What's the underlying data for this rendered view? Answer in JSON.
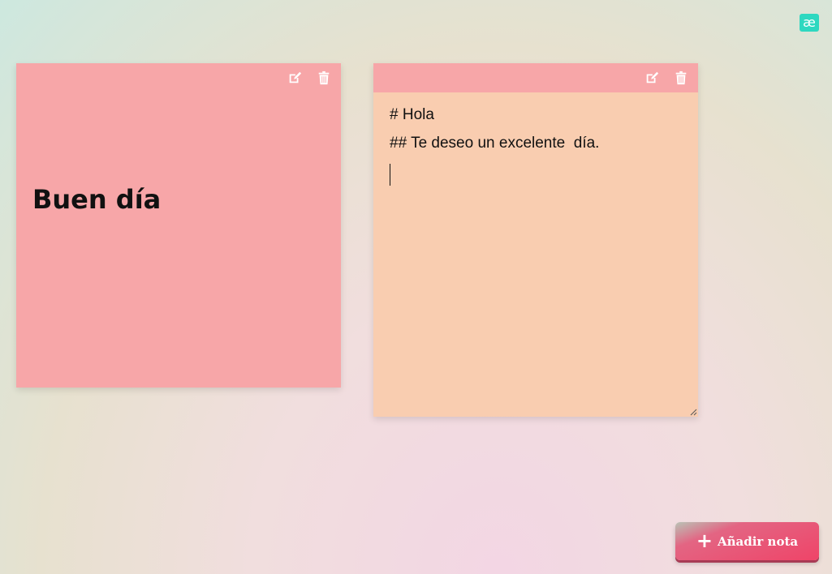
{
  "app": {
    "logo_text": "æ",
    "logo_color": "#2ed8c0"
  },
  "notes": [
    {
      "rendered_title": "Buen día",
      "background": "#f7a6a8",
      "actions": [
        {
          "name": "edit",
          "icon": "edit-icon"
        },
        {
          "name": "delete",
          "icon": "trash-icon"
        }
      ]
    },
    {
      "mode": "editing",
      "header_color": "#f7a6a8",
      "background": "#f9cdb0",
      "editor_lines": [
        "# Hola",
        "## Te deseo un excelente  día."
      ],
      "actions": [
        {
          "name": "edit",
          "icon": "edit-icon"
        },
        {
          "name": "delete",
          "icon": "trash-icon"
        }
      ]
    }
  ],
  "add_button": {
    "icon": "plus-icon",
    "plus": "+",
    "label": "Añadir nota",
    "color": "#ef4468"
  }
}
